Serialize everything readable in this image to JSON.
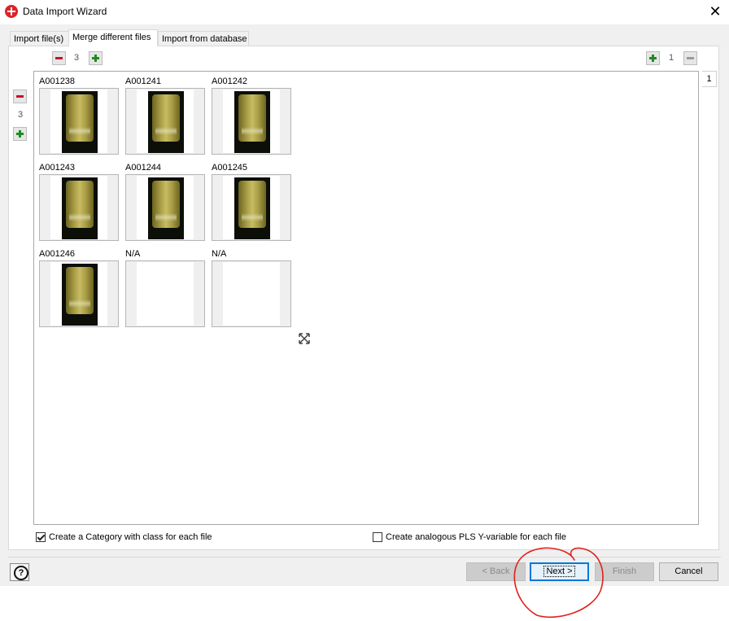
{
  "window": {
    "title": "Data Import Wizard",
    "close_glyph": "✕"
  },
  "tabs": [
    {
      "label": "Import file(s)",
      "active": false
    },
    {
      "label": "Merge different files",
      "active": true
    },
    {
      "label": "Import from database",
      "active": false
    }
  ],
  "columns_control": {
    "count": "3"
  },
  "rows_control": {
    "count": "3"
  },
  "pages_control": {
    "count": "1"
  },
  "page_tab": {
    "label": "1"
  },
  "images": [
    {
      "label": "A001238",
      "has_image": true
    },
    {
      "label": "A001241",
      "has_image": true
    },
    {
      "label": "A001242",
      "has_image": true
    },
    {
      "label": "A001243",
      "has_image": true
    },
    {
      "label": "A001244",
      "has_image": true
    },
    {
      "label": "A001245",
      "has_image": true
    },
    {
      "label": "A001246",
      "has_image": true
    },
    {
      "label": "N/A",
      "has_image": false
    },
    {
      "label": "N/A",
      "has_image": false
    }
  ],
  "options": {
    "create_category": {
      "label": "Create a Category with class for each file",
      "checked": true
    },
    "create_pls": {
      "label": "Create analogous PLS Y-variable for each file",
      "checked": false
    }
  },
  "buttons": {
    "help": "?",
    "back": "< Back",
    "next": "Next >",
    "finish": "Finish",
    "cancel": "Cancel"
  },
  "icons": {
    "app": "app-logo-icon",
    "expand": "expand-arrows-icon",
    "help": "question-circle-icon"
  },
  "colors": {
    "annotation": "#e0201c",
    "accent": "#0078d7"
  }
}
